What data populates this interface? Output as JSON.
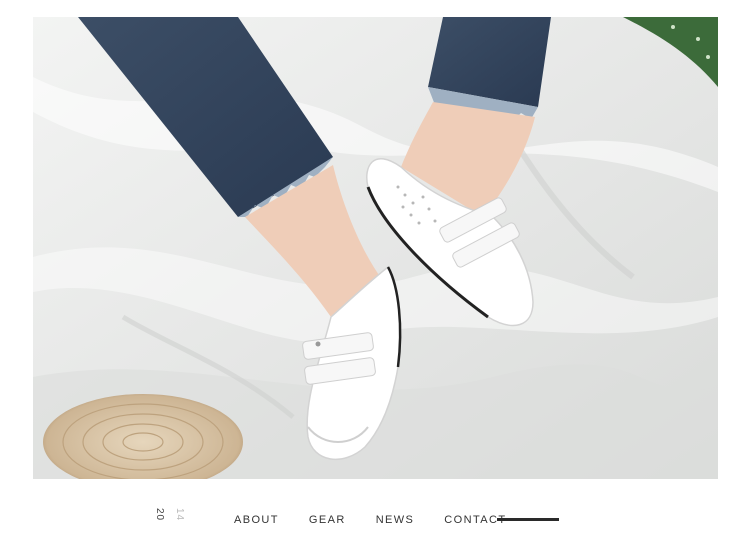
{
  "photo": {
    "subject": "photo-white-velcro-sneakers"
  },
  "footer": {
    "year_top": "20",
    "year_bottom": "14",
    "nav": [
      "ABOUT",
      "GEAR",
      "NEWS",
      "CONTACT"
    ]
  },
  "colors": {
    "nav_text": "#333333",
    "accent_bar": "#2a2a2a",
    "year_dim": "#b8b8b8"
  }
}
